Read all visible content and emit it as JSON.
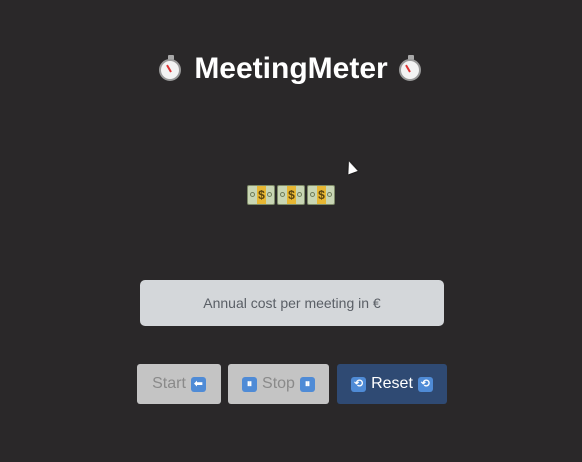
{
  "app": {
    "title": "MeetingMeter"
  },
  "header": {
    "left_icon": "stopwatch-icon",
    "right_icon": "stopwatch-icon"
  },
  "cost_display": {
    "icons": [
      "money-bill-icon",
      "money-bill-icon",
      "money-bill-icon"
    ]
  },
  "cost_input": {
    "placeholder": "Annual cost per meeting in €",
    "value": ""
  },
  "controls": {
    "start": {
      "label": "Start",
      "icon": "left-arrow-icon",
      "glyph": "⬅",
      "enabled": false
    },
    "stop": {
      "label": "Stop",
      "icon": "pause-icon",
      "glyph": "⏸",
      "enabled": false
    },
    "reset": {
      "label": "Reset",
      "icon": "repeat-icon",
      "glyph": "🔁",
      "enabled": true
    }
  },
  "colors": {
    "background": "#2a2829",
    "input_bg": "#d4d7da",
    "disabled_button_bg": "#c4c4c4",
    "reset_button_bg": "#2f4a73",
    "icon_blue": "#4f8bd6"
  }
}
